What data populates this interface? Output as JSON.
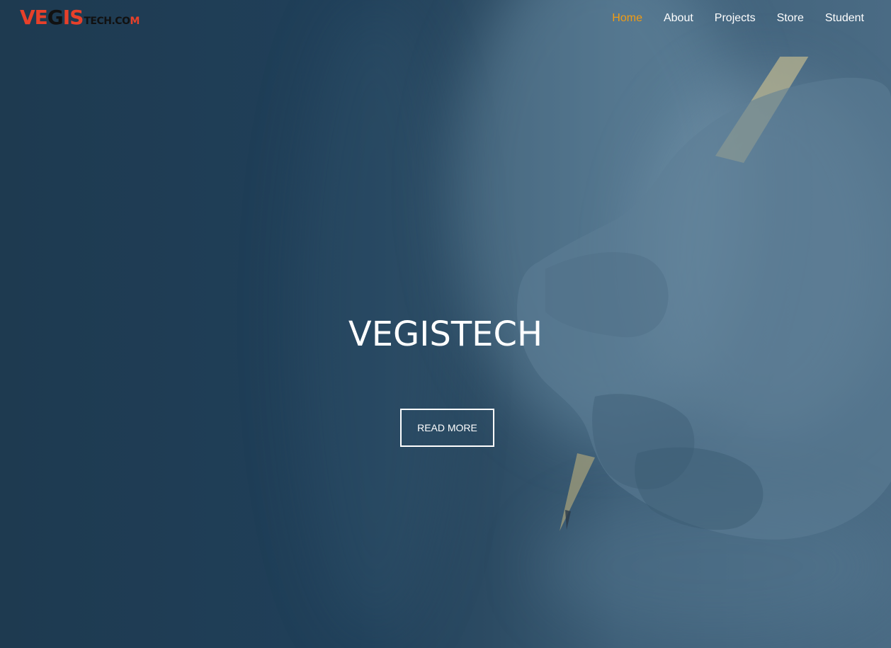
{
  "header": {
    "logo": {
      "main_red_1": "VE",
      "main_dark": "G",
      "main_red_2": "IS",
      "sub_dark": "TECH.CO",
      "sub_red": "M"
    },
    "nav": [
      {
        "label": "Home",
        "active": true
      },
      {
        "label": "About",
        "active": false
      },
      {
        "label": "Projects",
        "active": false
      },
      {
        "label": "Store",
        "active": false
      },
      {
        "label": "Student",
        "active": false
      }
    ]
  },
  "hero": {
    "title": "VEGISTECH",
    "button_label": "READ MORE",
    "background": "blurred photo of a hand writing with a pencil, blue overlay"
  },
  "colors": {
    "accent": "#f39c12",
    "logo_red": "#e8402a",
    "overlay_blue": "#1f3b51",
    "text": "#ffffff"
  }
}
